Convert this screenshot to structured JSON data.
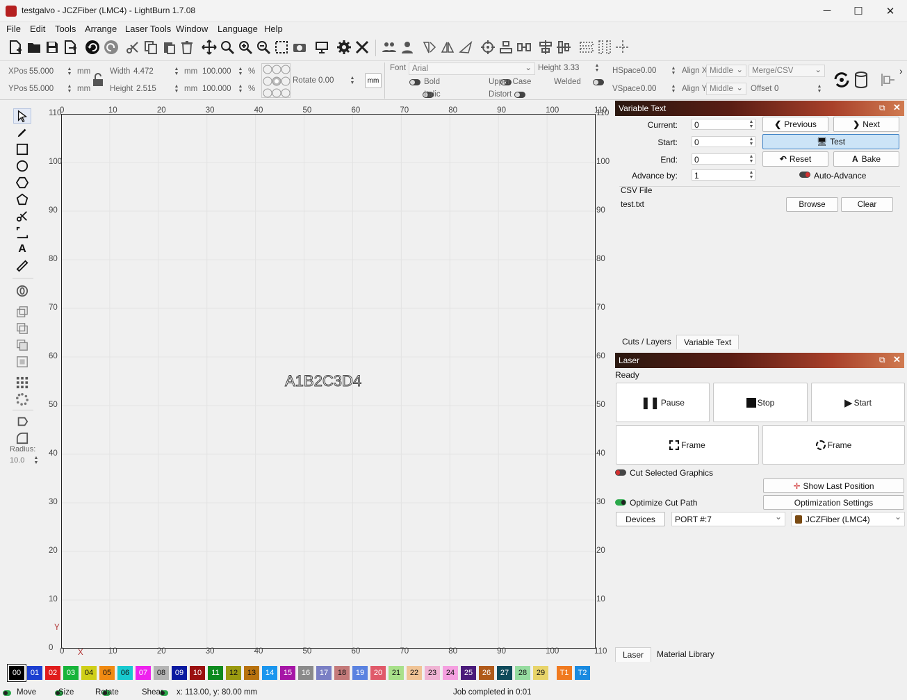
{
  "window": {
    "title": "testgalvo - JCZFiber (LMC4) - LightBurn 1.7.08",
    "minimize": "─",
    "maximize": "☐",
    "close": "✕"
  },
  "menu": [
    "File",
    "Edit",
    "Tools",
    "Arrange",
    "Laser Tools",
    "Window",
    "Language",
    "Help"
  ],
  "props": {
    "xpos_label": "XPos",
    "xpos": "55.000",
    "ypos_label": "YPos",
    "ypos": "55.000",
    "unit_mm": "mm",
    "width_label": "Width",
    "width": "4.472",
    "height_label": "Height",
    "height": "2.515",
    "scale_w": "100.000",
    "scale_h": "100.000",
    "pct": "%",
    "rotate_label": "Rotate",
    "rotate": "0.00",
    "mm_btn": "mm",
    "font_label": "Font",
    "font": "Arial",
    "fheight_label": "Height",
    "fheight": "3.33",
    "bold": "Bold",
    "italic": "Italic",
    "upper": "Upper Case",
    "distort": "Distort",
    "welded": "Welded",
    "hspace_label": "HSpace",
    "hspace": "0.00",
    "vspace_label": "VSpace",
    "vspace": "0.00",
    "alignx_label": "Align X",
    "alignx": "Middle",
    "aligny_label": "Align Y",
    "aligny": "Middle",
    "merge": "Merge/CSV",
    "offset_label": "Offset",
    "offset": "0"
  },
  "tools": {
    "radius_label": "Radius:",
    "radius": "10.0"
  },
  "canvas": {
    "text": "A1B2C3D4",
    "top_ticks": [
      "0",
      "10",
      "20",
      "30",
      "40",
      "50",
      "60",
      "70",
      "80",
      "90",
      "100",
      "110"
    ],
    "bottom_ticks": [
      "0",
      "10",
      "20",
      "30",
      "40",
      "50",
      "60",
      "70",
      "80",
      "90",
      "100",
      "110"
    ],
    "left_ticks": [
      "110",
      "100",
      "90",
      "80",
      "70",
      "60",
      "50",
      "40",
      "30",
      "20",
      "10",
      "0"
    ],
    "right_ticks": [
      "110",
      "100",
      "90",
      "80",
      "70",
      "60",
      "50",
      "40",
      "30",
      "20",
      "10"
    ],
    "x_axis": "X",
    "y_axis": "Y"
  },
  "variable_text": {
    "title": "Variable Text",
    "current_label": "Current:",
    "current": "0",
    "start_label": "Start:",
    "start": "0",
    "end_label": "End:",
    "end": "0",
    "advance_label": "Advance by:",
    "advance": "1",
    "previous": "Previous",
    "next": "Next",
    "test": "Test",
    "reset": "Reset",
    "bake": "Bake",
    "auto_advance": "Auto-Advance",
    "csv_label": "CSV File",
    "csv_file": "test.txt",
    "browse": "Browse",
    "clear": "Clear"
  },
  "tabs_top": [
    "Cuts / Layers",
    "Variable Text"
  ],
  "laser": {
    "title": "Laser",
    "status": "Ready",
    "pause": "Pause",
    "stop": "Stop",
    "start": "Start",
    "frame1": "Frame",
    "frame2": "Frame",
    "cut_selected": "Cut Selected Graphics",
    "show_last": "Show Last Position",
    "optimize": "Optimize Cut Path",
    "opt_settings": "Optimization Settings",
    "devices": "Devices",
    "port": "PORT #:7",
    "device": "JCZFiber (LMC4)"
  },
  "tabs_bottom": [
    "Laser",
    "Material Library"
  ],
  "palette": [
    {
      "label": "00",
      "color": "#000000",
      "fg": "#ffffff"
    },
    {
      "label": "01",
      "color": "#1c3fd1",
      "fg": "#ffffff"
    },
    {
      "label": "02",
      "color": "#e01c1c",
      "fg": "#ffffff"
    },
    {
      "label": "03",
      "color": "#17b43a",
      "fg": "#ffffff"
    },
    {
      "label": "04",
      "color": "#cfcf18",
      "fg": "#111111"
    },
    {
      "label": "05",
      "color": "#f08a12",
      "fg": "#111111"
    },
    {
      "label": "06",
      "color": "#18c9cf",
      "fg": "#111111"
    },
    {
      "label": "07",
      "color": "#ee22ee",
      "fg": "#ffffff"
    },
    {
      "label": "08",
      "color": "#b4b4b4",
      "fg": "#111111"
    },
    {
      "label": "09",
      "color": "#0a1aa0",
      "fg": "#ffffff"
    },
    {
      "label": "10",
      "color": "#9a1010",
      "fg": "#ffffff"
    },
    {
      "label": "11",
      "color": "#0d8a1e",
      "fg": "#ffffff"
    },
    {
      "label": "12",
      "color": "#9a9a10",
      "fg": "#111111"
    },
    {
      "label": "13",
      "color": "#b8720e",
      "fg": "#111111"
    },
    {
      "label": "14",
      "color": "#1a96ee",
      "fg": "#ffffff"
    },
    {
      "label": "15",
      "color": "#a616a6",
      "fg": "#ffffff"
    },
    {
      "label": "16",
      "color": "#8a8a8a",
      "fg": "#ffffff"
    },
    {
      "label": "17",
      "color": "#7a7fc4",
      "fg": "#ffffff"
    },
    {
      "label": "18",
      "color": "#c47a7a",
      "fg": "#111111"
    },
    {
      "label": "19",
      "color": "#5a82e0",
      "fg": "#ffffff"
    },
    {
      "label": "20",
      "color": "#e05a6a",
      "fg": "#ffffff"
    },
    {
      "label": "21",
      "color": "#a8e08a",
      "fg": "#111111"
    },
    {
      "label": "22",
      "color": "#f0c496",
      "fg": "#111111"
    },
    {
      "label": "23",
      "color": "#f0b4d4",
      "fg": "#111111"
    },
    {
      "label": "24",
      "color": "#f5a0e0",
      "fg": "#111111"
    },
    {
      "label": "25",
      "color": "#4a1a7a",
      "fg": "#ffffff"
    },
    {
      "label": "26",
      "color": "#b05a1a",
      "fg": "#ffffff"
    },
    {
      "label": "27",
      "color": "#0e4a5a",
      "fg": "#ffffff"
    },
    {
      "label": "28",
      "color": "#96dca0",
      "fg": "#111111"
    },
    {
      "label": "29",
      "color": "#e8d46a",
      "fg": "#111111"
    },
    {
      "label": "T1",
      "color": "#f07a20",
      "fg": "#ffffff"
    },
    {
      "label": "T2",
      "color": "#1a8ae0",
      "fg": "#ffffff"
    }
  ],
  "status": {
    "move": "Move",
    "size": "Size",
    "rotate": "Rotate",
    "shear": "Shear",
    "coords": "x: 113.00, y: 80.00 mm",
    "job": "Job completed in 0:01"
  }
}
